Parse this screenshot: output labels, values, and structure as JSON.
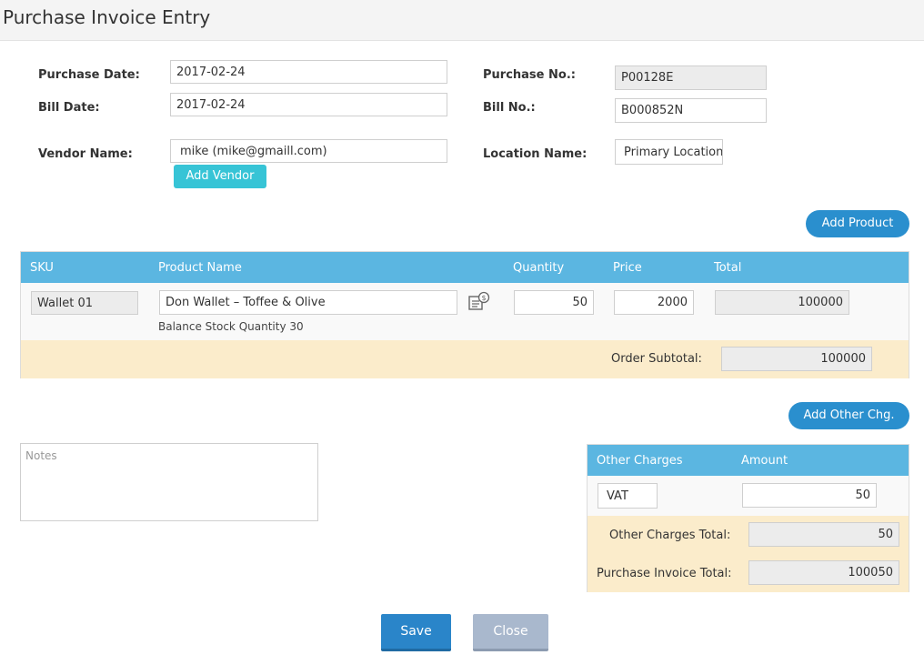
{
  "page": {
    "title": "Purchase Invoice Entry"
  },
  "form": {
    "purchase_date_label": "Purchase Date:",
    "purchase_date": "2017-02-24",
    "bill_date_label": "Bill Date:",
    "bill_date": "2017-02-24",
    "vendor_label": "Vendor Name:",
    "vendor": "mike (mike@gmaill.com)",
    "add_vendor": "Add Vendor",
    "purchase_no_label": "Purchase No.:",
    "purchase_no": "P00128E",
    "bill_no_label": "Bill No.:",
    "bill_no": "B000852N",
    "location_label": "Location Name:",
    "location": "Primary Location"
  },
  "products": {
    "add_button": "Add Product",
    "columns": [
      "SKU",
      "Product Name",
      "Quantity",
      "Price",
      "Total"
    ],
    "rows": [
      {
        "sku": "Wallet 01",
        "name": "Don Wallet – Toffee & Olive",
        "stock_note": "Balance Stock Quantity 30",
        "quantity": "50",
        "price": "2000",
        "total": "100000"
      }
    ],
    "subtotal_label": "Order Subtotal:",
    "subtotal": "100000"
  },
  "notes": {
    "placeholder": "Notes"
  },
  "charges": {
    "add_button": "Add Other Chg.",
    "columns": [
      "Other Charges",
      "Amount"
    ],
    "rows": [
      {
        "name": "VAT",
        "amount": "50"
      }
    ],
    "charges_total_label": "Other Charges Total:",
    "charges_total": "50",
    "invoice_total_label": "Purchase Invoice Total:",
    "invoice_total": "100050"
  },
  "actions": {
    "save": "Save",
    "close": "Close"
  },
  "colors": {
    "header_blue": "#5bb6e1",
    "tan": "#fbeccb",
    "primary": "#2a8fce",
    "teal": "#37c4d6"
  }
}
